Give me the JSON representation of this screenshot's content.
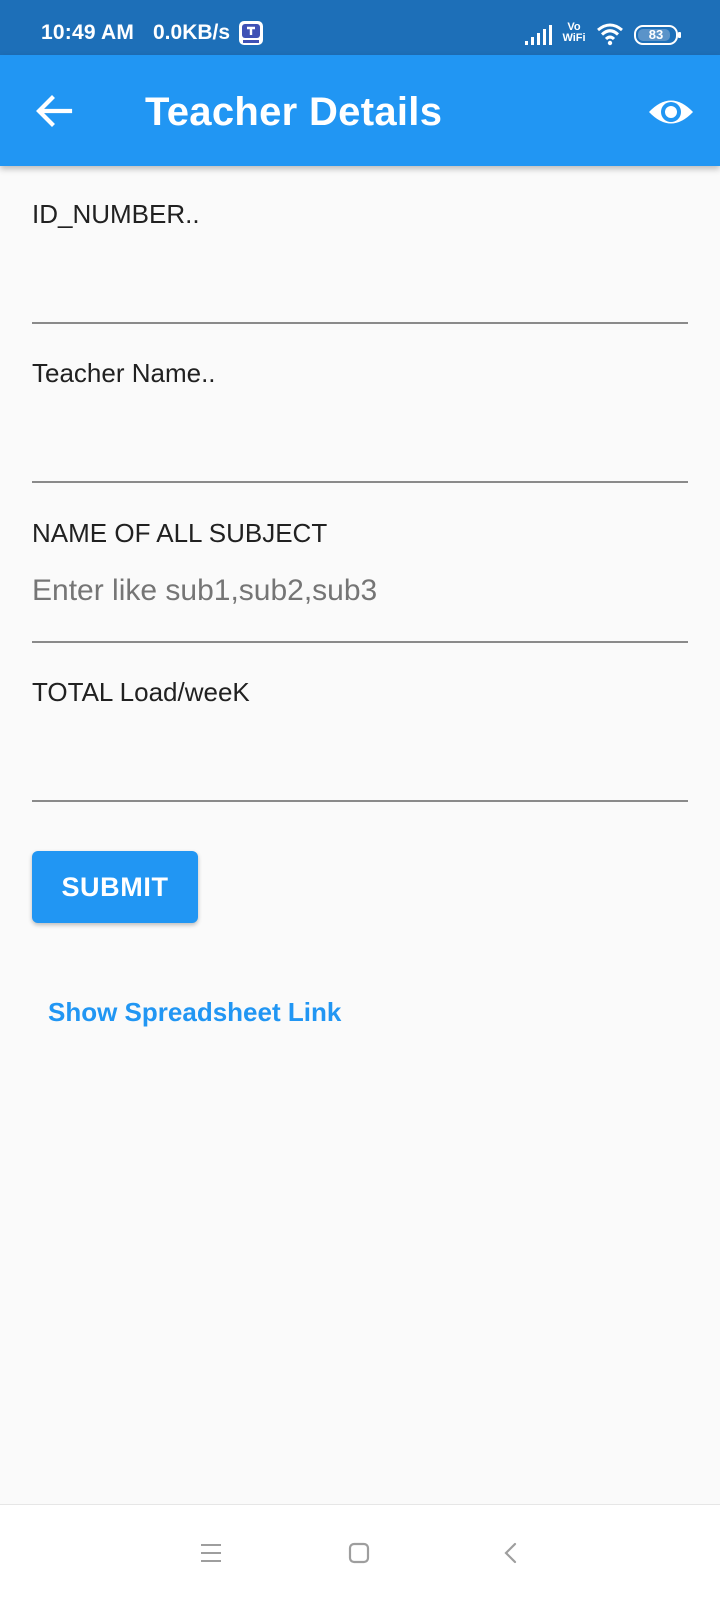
{
  "status_bar": {
    "time": "10:49 AM",
    "speed": "0.0KB/s",
    "vowifi_line1": "Vo",
    "vowifi_line2": "WiFi",
    "battery": "83",
    "icons": [
      "app-notification-icon",
      "signal-icon",
      "vowifi-icon",
      "wifi-icon",
      "battery-icon"
    ]
  },
  "app_bar": {
    "title": "Teacher Details",
    "back_icon": "arrow-back-icon",
    "action_icon": "eye-icon",
    "color": "#2196f3"
  },
  "form": {
    "fields": [
      {
        "label": "ID_NUMBER..",
        "value": "",
        "placeholder": ""
      },
      {
        "label": "Teacher Name..",
        "value": "",
        "placeholder": ""
      },
      {
        "label": "NAME OF ALL SUBJECT",
        "value": "",
        "placeholder": "Enter like sub1,sub2,sub3"
      },
      {
        "label": "TOTAL Load/weeK",
        "value": "",
        "placeholder": ""
      }
    ],
    "submit_label": "SUBMIT",
    "spreadsheet_link": "Show Spreadsheet Link"
  },
  "nav_bar": {
    "icons": [
      "menu-icon",
      "home-square-icon",
      "back-chevron-icon"
    ]
  },
  "colors": {
    "status_bar": "#1d6fb8",
    "primary": "#2196f3",
    "background": "#fafafa"
  }
}
